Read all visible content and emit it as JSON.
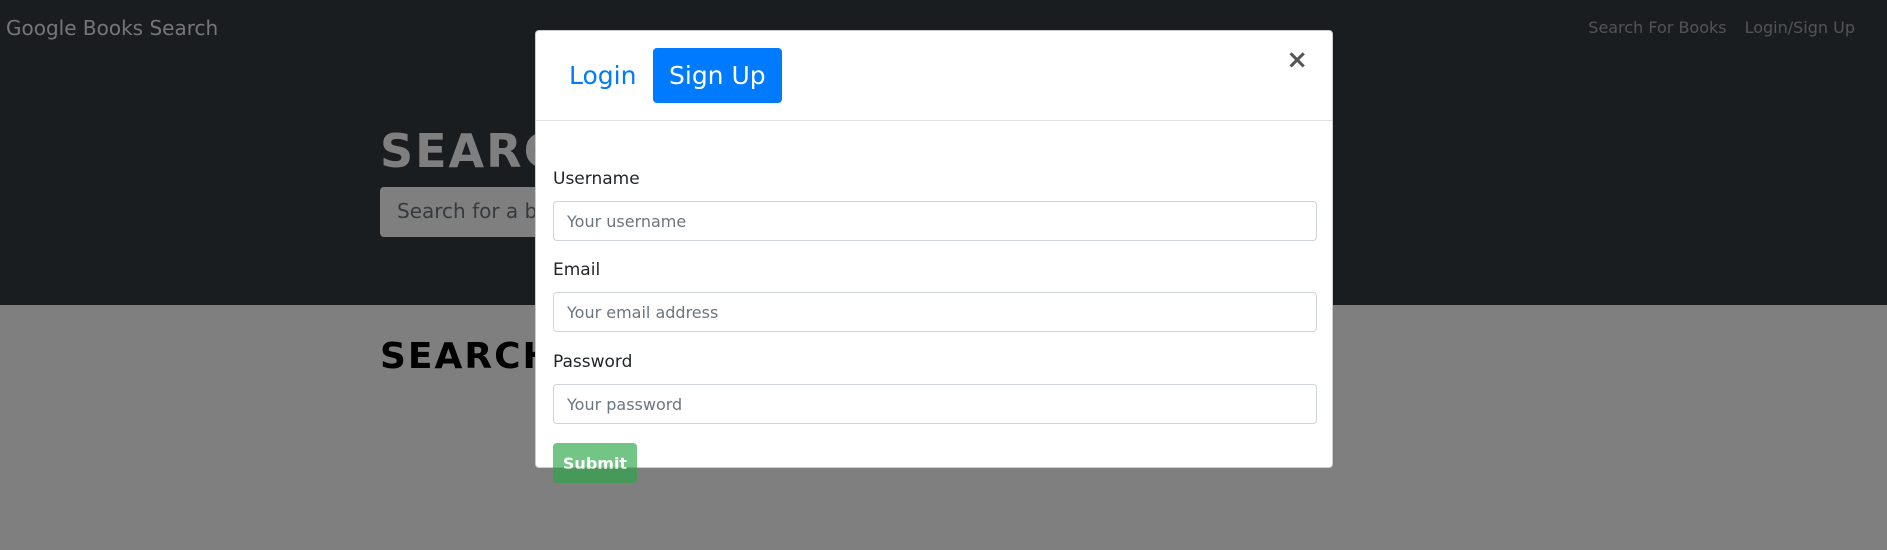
{
  "navbar": {
    "brand": "Google Books Search",
    "links": [
      "Search For Books",
      "Login/Sign Up"
    ]
  },
  "hero": {
    "title": "SEARCH FOR BOOKS!",
    "search_placeholder": "Search for a book"
  },
  "results": {
    "title": "SEARCH FOR A BOOK TO BEGIN"
  },
  "modal": {
    "tabs": [
      "Login",
      "Sign Up"
    ],
    "active_tab": "Sign Up",
    "close": "×",
    "fields": [
      {
        "label": "Username",
        "placeholder": "Your username"
      },
      {
        "label": "Email",
        "placeholder": "Your email address"
      },
      {
        "label": "Password",
        "placeholder": "Your password"
      }
    ],
    "submit": "Submit"
  },
  "colors": {
    "navbar_bg": "#343a40",
    "primary": "#007bff",
    "success": "#28a745",
    "backdrop": "rgba(0,0,0,0.5)"
  }
}
